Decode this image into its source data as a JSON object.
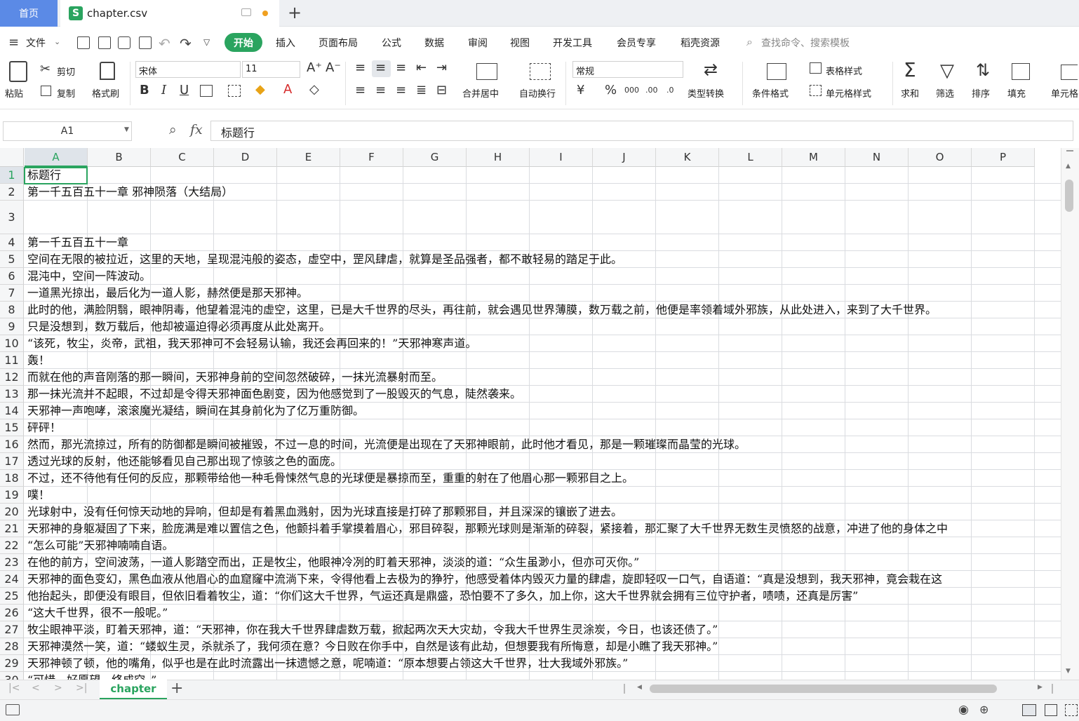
{
  "tabs": {
    "home": "首页",
    "file": "chapter.csv",
    "new": "+"
  },
  "menu": {
    "file": "文件",
    "items": [
      "开始",
      "插入",
      "页面布局",
      "公式",
      "数据",
      "审阅",
      "视图",
      "开发工具",
      "会员专享",
      "稻壳资源"
    ],
    "search_placeholder": "查找命令、搜索模板"
  },
  "ribbon": {
    "paste": "粘贴",
    "cut": "剪切",
    "copy": "复制",
    "format_painter": "格式刷",
    "font_name": "宋体",
    "font_size": "11",
    "merge_center": "合并居中",
    "wrap_text": "自动换行",
    "number_format": "常规",
    "type_convert": "类型转换",
    "conditional_format": "条件格式",
    "table_style": "表格样式",
    "cell_style": "单元格样式",
    "sum": "求和",
    "filter": "筛选",
    "sort": "排序",
    "fill": "填充",
    "cell": "单元格",
    "bold": "B",
    "italic": "I",
    "underline": "U",
    "currency": "¥",
    "percent": "%"
  },
  "formula_bar": {
    "name_box": "A1",
    "fx": "fx",
    "content": "标题行"
  },
  "columns": [
    "A",
    "B",
    "C",
    "D",
    "E",
    "F",
    "G",
    "H",
    "I",
    "J",
    "K",
    "L",
    "M",
    "N",
    "O",
    "P"
  ],
  "rows": [
    {
      "n": "1",
      "text": "标题行"
    },
    {
      "n": "2",
      "text": "第一千五百五十一章 邪神陨落（大结局）"
    },
    {
      "n": "3",
      "text": ""
    },
    {
      "n": "4",
      "text": "第一千五百五十一章"
    },
    {
      "n": "5",
      "text": "空间在无限的被拉近，这里的天地，呈现混沌般的姿态，虚空中，罡风肆虐，就算是圣品强者，都不敢轻易的踏足于此。"
    },
    {
      "n": "6",
      "text": "混沌中，空间一阵波动。"
    },
    {
      "n": "7",
      "text": "一道黑光掠出，最后化为一道人影，赫然便是那天邪神。"
    },
    {
      "n": "8",
      "text": "此时的他，满脸阴翳，眼神阴毒，他望着混沌的虚空，这里，已是大千世界的尽头，再往前，就会遇见世界薄膜，数万载之前，他便是率领着域外邪族，从此处进入，来到了大千世界。"
    },
    {
      "n": "9",
      "text": "只是没想到，数万载后，他却被逼迫得必须再度从此处离开。"
    },
    {
      "n": "10",
      "text": "“该死，牧尘，炎帝，武祖，我天邪神可不会轻易认输，我还会再回来的！”天邪神寒声道。"
    },
    {
      "n": "11",
      "text": "轰！"
    },
    {
      "n": "12",
      "text": "而就在他的声音刚落的那一瞬间，天邪神身前的空间忽然破碎，一抹光流暴射而至。"
    },
    {
      "n": "13",
      "text": "那一抹光流并不起眼，不过却是令得天邪神面色剧变，因为他感觉到了一股毁灭的气息，陡然袭来。"
    },
    {
      "n": "14",
      "text": "天邪神一声咆哮，滚滚魔光凝结，瞬间在其身前化为了亿万重防御。"
    },
    {
      "n": "15",
      "text": "砰砰！"
    },
    {
      "n": "16",
      "text": "然而，那光流掠过，所有的防御都是瞬间被摧毁，不过一息的时间，光流便是出现在了天邪神眼前，此时他才看见，那是一颗璀璨而晶莹的光球。"
    },
    {
      "n": "17",
      "text": "透过光球的反射，他还能够看见自己那出现了惊骇之色的面庞。"
    },
    {
      "n": "18",
      "text": "不过，还不待他有任何的反应，那颗带给他一种毛骨悚然气息的光球便是暴掠而至，重重的射在了他眉心那一颗邪目之上。"
    },
    {
      "n": "19",
      "text": "噗！"
    },
    {
      "n": "20",
      "text": "光球射中，没有任何惊天动地的异响，但却是有着黑血溅射，因为光球直接是打碎了那颗邪目，并且深深的镶嵌了进去。"
    },
    {
      "n": "21",
      "text": "天邪神的身躯凝固了下来，脸庞满是难以置信之色，他颤抖着手掌摸着眉心，邪目碎裂，那颗光球则是渐渐的碎裂，紧接着，那汇聚了大千世界无数生灵愤怒的战意，冲进了他的身体之中"
    },
    {
      "n": "22",
      "text": "“怎么可能”天邪神喃喃自语。"
    },
    {
      "n": "23",
      "text": "在他的前方，空间波荡，一道人影踏空而出，正是牧尘，他眼神冷冽的盯着天邪神，淡淡的道：“众生虽渺小，但亦可灭你。”"
    },
    {
      "n": "24",
      "text": "天邪神的面色变幻，黑色血液从他眉心的血窟窿中流淌下来，令得他看上去极为的狰狞，他感受着体内毁灭力量的肆虐，旋即轻叹一口气，自语道：“真是没想到，我天邪神，竟会栽在这"
    },
    {
      "n": "25",
      "text": "他抬起头，即便没有眼目，但依旧看着牧尘，道：“你们这大千世界，气运还真是鼎盛，恐怕要不了多久，加上你，这大千世界就会拥有三位守护者，啧啧，还真是厉害”"
    },
    {
      "n": "26",
      "text": "“这大千世界，很不一般呢。”"
    },
    {
      "n": "27",
      "text": "牧尘眼神平淡，盯着天邪神，道：“天邪神，你在我大千世界肆虐数万载，掀起两次天大灾劫，令我大千世界生灵涂炭，今日，也该还债了。”"
    },
    {
      "n": "28",
      "text": "天邪神漠然一笑，道：“蝼蚁生灵，杀就杀了，我何须在意？今日败在你手中，自然是该有此劫，但想要我有所悔意，却是小瞧了我天邪神。”"
    },
    {
      "n": "29",
      "text": "天邪神顿了顿，他的嘴角，似乎也是在此时流露出一抹遗憾之意，呢喃道：“原本想要占领这大千世界，壮大我域外邪族。”"
    },
    {
      "n": "30",
      "text": "“可惜，好愿望，终成空。”"
    }
  ],
  "sheet": {
    "name": "chapter",
    "add": "+"
  },
  "colors": {
    "accent": "#2aa45f",
    "home_tab": "#5b8ae6"
  }
}
